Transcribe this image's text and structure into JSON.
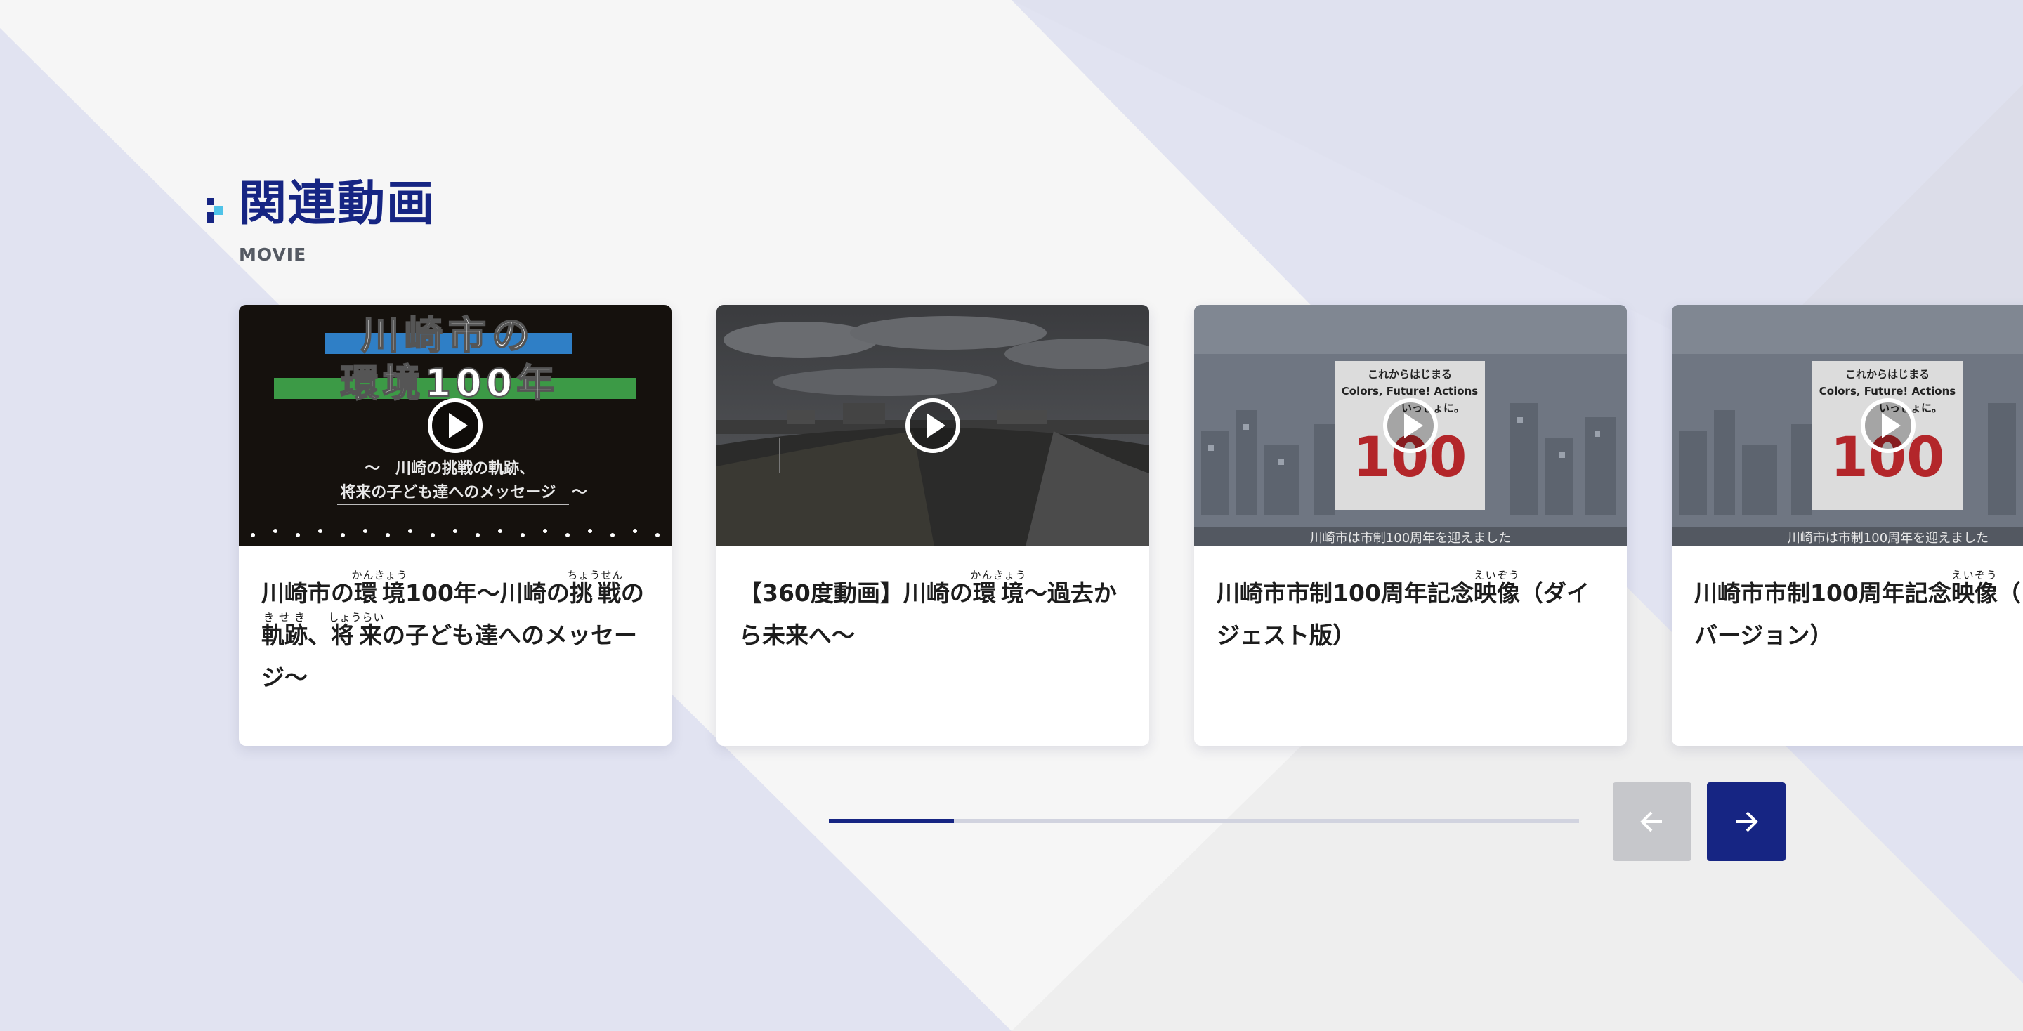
{
  "section": {
    "title": "関連動画",
    "subtitle": "MOVIE"
  },
  "colors": {
    "brand_navy": "#162583",
    "accent_cyan": "#4fc3e8",
    "background_lavender": "#e1e3f1",
    "card_white": "#ffffff",
    "prev_disabled": "#c6c7cb"
  },
  "cards": [
    {
      "title_segments": [
        {
          "text": "川崎市の"
        },
        {
          "text": "環境",
          "ruby": "かんきょう"
        },
        {
          "text": "100年〜川崎の"
        },
        {
          "text": "挑戦",
          "ruby": "ちょうせん"
        },
        {
          "text": "の"
        },
        {
          "text": "軌跡",
          "ruby": "きせき"
        },
        {
          "text": "、"
        },
        {
          "text": "将来",
          "ruby": "しょうらい"
        },
        {
          "text": "の子ども達へのメッセージ〜"
        }
      ],
      "thumbnail": {
        "line1": "川崎市の",
        "line2": "環境100年",
        "caption1": "〜　川崎の挑戦の軌跡、",
        "caption2": "将来の子ども達へのメッセージ　〜"
      }
    },
    {
      "title_segments": [
        {
          "text": "【360度動画】川崎の"
        },
        {
          "text": "環境",
          "ruby": "かんきょう"
        },
        {
          "text": "〜過去から未来へ〜"
        }
      ]
    },
    {
      "title_segments": [
        {
          "text": "川崎市市制100周年記念"
        },
        {
          "text": "映像",
          "ruby": "えいぞう"
        },
        {
          "text": "（ダイジェスト版）"
        }
      ],
      "thumbnail": {
        "poster1": "これからはじまる",
        "poster2": "Colors, Future! Actions",
        "poster3": "いっしょに。",
        "big_number": "100",
        "banner": "川崎市は市制100周年を迎えました"
      }
    },
    {
      "title_segments": [
        {
          "text": "川崎市市制100周年記念"
        },
        {
          "text": "映像",
          "ruby": "えいぞう"
        },
        {
          "text": "（"
        },
        {
          "text": "バージョン）"
        }
      ],
      "thumbnail": {
        "poster1": "これからはじまる",
        "poster2": "Colors, Future! Actions",
        "poster3": "いっしょに。",
        "big_number": "100",
        "banner": "川崎市は市制100周年を迎えました"
      }
    }
  ],
  "carousel": {
    "progress_fraction": 0.167
  },
  "icons": {
    "play": "play-circle-icon",
    "prev": "arrow-left-icon",
    "next": "arrow-right-icon"
  }
}
